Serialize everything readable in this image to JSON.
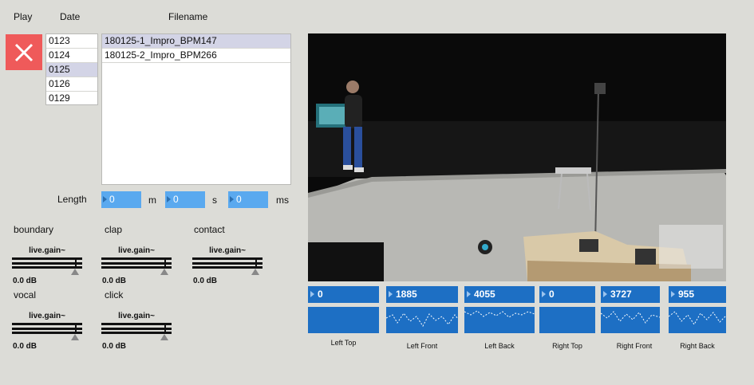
{
  "headers": {
    "play": "Play",
    "date": "Date",
    "filename": "Filename"
  },
  "play_button": {
    "icon": "close-icon",
    "color": "#ef5a5a"
  },
  "dates": {
    "items": [
      "0123",
      "0124",
      "0125",
      "0126",
      "0129"
    ],
    "selected": "0125"
  },
  "files": {
    "items": [
      "180125-1_Impro_BPM147",
      "180125-2_Impro_BPM266"
    ],
    "selected": "180125-1_Impro_BPM147"
  },
  "length": {
    "label": "Length",
    "minutes": {
      "value": "0",
      "unit": "m"
    },
    "seconds": {
      "value": "0",
      "unit": "s"
    },
    "milliseconds": {
      "value": "0",
      "unit": "ms"
    }
  },
  "gains": [
    {
      "label": "boundary",
      "title": "live.gain~",
      "value": "0.0 dB"
    },
    {
      "label": "clap",
      "title": "live.gain~",
      "value": "0.0 dB"
    },
    {
      "label": "contact",
      "title": "live.gain~",
      "value": "0.0 dB"
    },
    {
      "label": "vocal",
      "title": "live.gain~",
      "value": "0.0 dB"
    },
    {
      "label": "click",
      "title": "live.gain~",
      "value": "0.0 dB"
    }
  ],
  "sensors": [
    {
      "value": "0",
      "label": "Left Top",
      "active": false
    },
    {
      "value": "1885",
      "label": "Left Front",
      "active": true
    },
    {
      "value": "4055",
      "label": "Left Back",
      "active": true
    },
    {
      "value": "0",
      "label": "Right Top",
      "active": false
    },
    {
      "value": "3727",
      "label": "Right Front",
      "active": true
    },
    {
      "value": "955",
      "label": "Right Back",
      "active": true
    }
  ],
  "colors": {
    "number_box": "#5aa9ef",
    "sensor_blue": "#1d6fc4",
    "list_selection": "#d3d4e6"
  }
}
